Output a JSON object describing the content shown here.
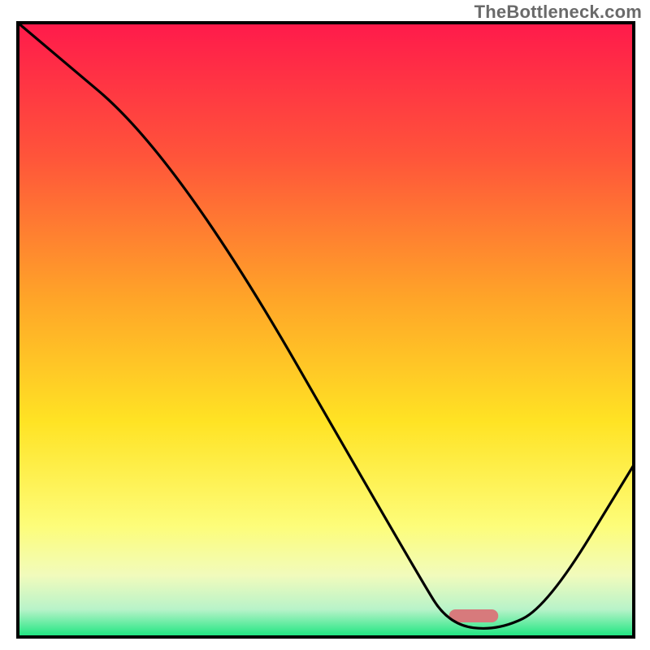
{
  "attribution": "TheBottleneck.com",
  "chart_data": {
    "type": "line",
    "title": "",
    "xlabel": "",
    "ylabel": "",
    "xlim": [
      0,
      100
    ],
    "ylim": [
      0,
      100
    ],
    "x": [
      0,
      26,
      65,
      70,
      78,
      86,
      100
    ],
    "values": [
      100,
      78,
      10,
      2,
      1,
      5,
      28
    ],
    "optimal_zone": {
      "x_start": 70,
      "x_end": 78,
      "color": "#d77a7c"
    },
    "background_gradient": {
      "stops": [
        {
          "offset": 0.0,
          "color": "#ff1a4b"
        },
        {
          "offset": 0.22,
          "color": "#ff553a"
        },
        {
          "offset": 0.45,
          "color": "#ffa528"
        },
        {
          "offset": 0.65,
          "color": "#ffe324"
        },
        {
          "offset": 0.82,
          "color": "#fdfd7a"
        },
        {
          "offset": 0.9,
          "color": "#f1fbbc"
        },
        {
          "offset": 0.955,
          "color": "#b8f3c9"
        },
        {
          "offset": 1.0,
          "color": "#19e57e"
        }
      ]
    },
    "frame_color": "#000000",
    "line_color": "#000000"
  }
}
